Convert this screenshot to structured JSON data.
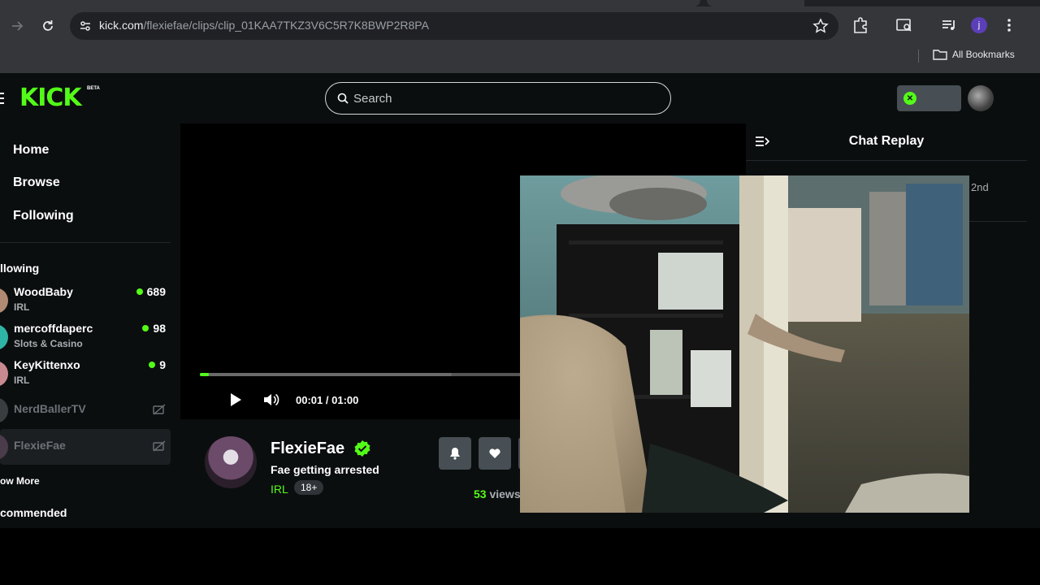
{
  "browser": {
    "url_host": "kick.com",
    "url_path": "/flexiefae/clips/clip_01KAA7TKZ3V6C5R7K8BWP2R8PA",
    "profile_initial": "j",
    "bookmarks_label": "All Bookmarks"
  },
  "header": {
    "logo": "KICK",
    "logo_badge": "BETA",
    "search_placeholder": "Search"
  },
  "sidebar": {
    "nav": [
      "Home",
      "Browse",
      "Following"
    ],
    "following_heading": "llowing",
    "channels": [
      {
        "name": "WoodBaby",
        "category": "IRL",
        "viewers": "689"
      },
      {
        "name": "mercoffdaperc",
        "category": "Slots & Casino",
        "viewers": "98"
      },
      {
        "name": "KeyKittenxo",
        "category": "IRL",
        "viewers": "9"
      },
      {
        "name": "NerdBallerTV",
        "category": "",
        "viewers": ""
      },
      {
        "name": "FlexieFae",
        "category": "",
        "viewers": ""
      }
    ],
    "show_more": "ow More",
    "recommended_heading": "commended"
  },
  "player": {
    "current_time": "00:01",
    "separator": "/",
    "duration": "01:00",
    "progress_fraction": 0.017,
    "buffered_fraction": 0.47
  },
  "streamer": {
    "name": "FlexieFae",
    "clip_title": "Fae getting arrested",
    "category": "IRL",
    "badge": "18+",
    "views_count": "53",
    "views_label": " views"
  },
  "chat": {
    "title": "Chat Replay",
    "fragment": "2nd"
  },
  "colors": {
    "accent": "#53fc18",
    "page_bg": "#0b0e0f",
    "chrome_bg": "#35363a"
  }
}
